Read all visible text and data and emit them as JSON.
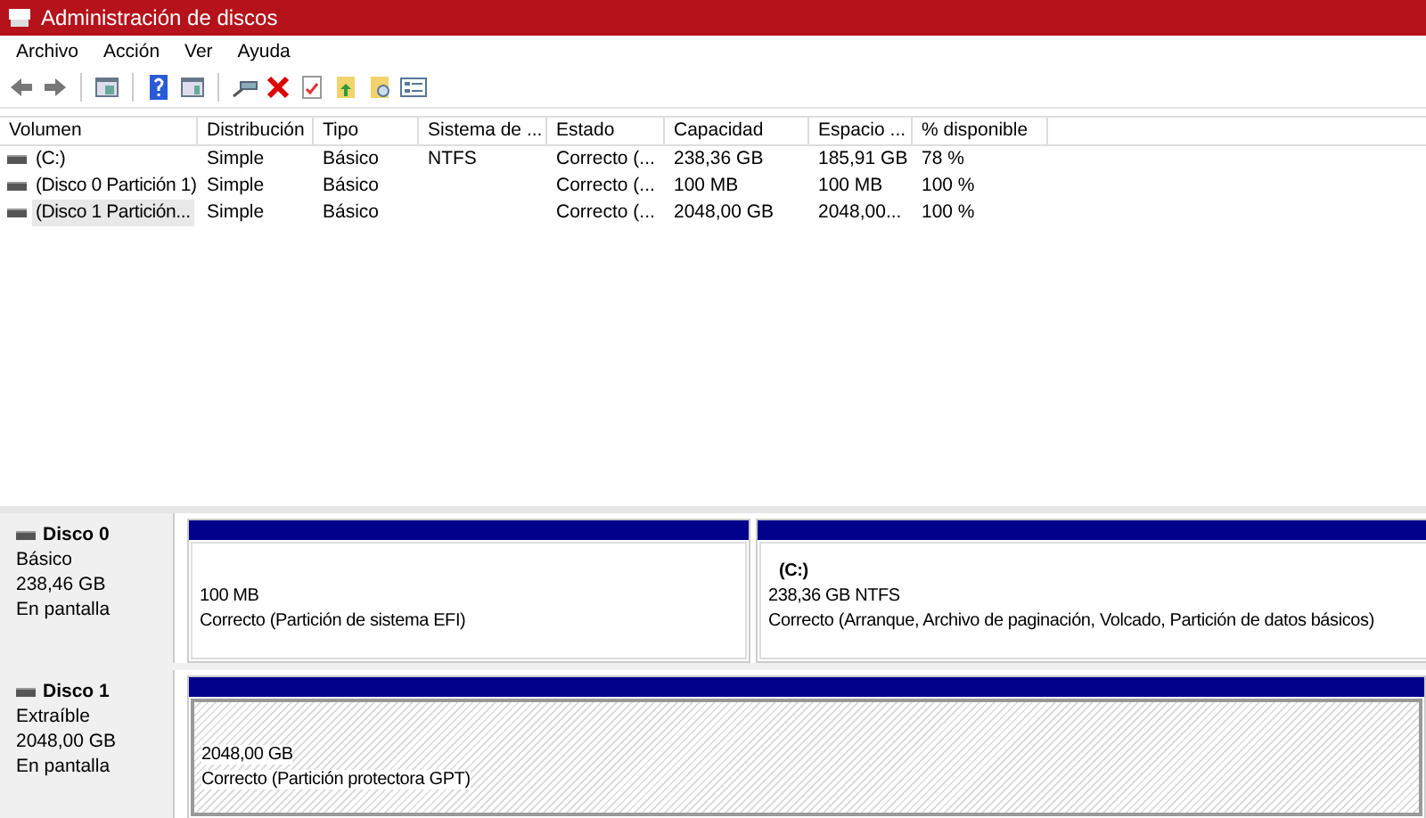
{
  "window": {
    "title": "Administración de discos"
  },
  "menu": [
    "Archivo",
    "Acción",
    "Ver",
    "Ayuda"
  ],
  "table": {
    "columns": [
      "Volumen",
      "Distribución",
      "Tipo",
      "Sistema de ...",
      "Estado",
      "Capacidad",
      "Espacio ...",
      "% disponible"
    ],
    "rows": [
      {
        "selected": false,
        "cells": [
          "(C:)",
          "Simple",
          "Básico",
          "NTFS",
          "Correcto (...",
          "238,36 GB",
          "185,91 GB",
          "78 %"
        ]
      },
      {
        "selected": false,
        "cells": [
          "(Disco 0 Partición 1)",
          "Simple",
          "Básico",
          "",
          "Correcto (...",
          "100 MB",
          "100 MB",
          "100 %"
        ]
      },
      {
        "selected": true,
        "cells": [
          "(Disco 1 Partición...",
          "Simple",
          "Básico",
          "",
          "Correcto (...",
          "2048,00 GB",
          "2048,00...",
          "100 %"
        ]
      }
    ]
  },
  "disks": [
    {
      "name": "Disco 0",
      "type": "Básico",
      "size": "238,46 GB",
      "status": "En pantalla",
      "partitions": [
        {
          "selected": false,
          "size": "100 MB",
          "status": "Correcto (Partición de sistema EFI)"
        },
        {
          "selected": false,
          "name": "(C:)",
          "size": "238,36 GB NTFS",
          "status": "Correcto (Arranque, Archivo de paginación, Volcado, Partición de datos básicos)"
        }
      ]
    },
    {
      "name": "Disco 1",
      "type": "Extraíble",
      "size": "2048,00 GB",
      "status": "En pantalla",
      "partitions": [
        {
          "selected": true,
          "size": "2048,00 GB",
          "status": "Correcto (Partición protectora GPT)"
        }
      ]
    }
  ]
}
